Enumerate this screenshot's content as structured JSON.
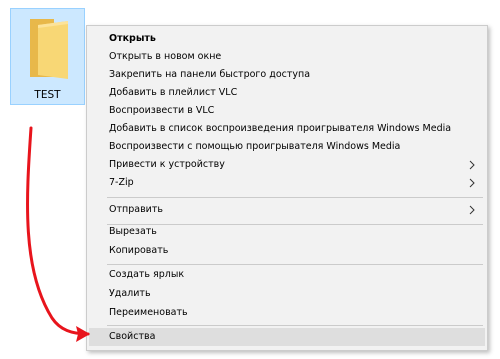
{
  "folder": {
    "name": "TEST",
    "icon": "folder-icon",
    "highlight_color": "#cce8ff"
  },
  "context_menu": {
    "items": [
      {
        "label": "Открыть",
        "bold": true
      },
      {
        "label": "Открыть в новом окне"
      },
      {
        "label": "Закрепить на панели быстрого доступа"
      },
      {
        "label": "Добавить в плейлист VLC"
      },
      {
        "label": "Воспроизвести в VLC"
      },
      {
        "label": "Добавить в список воспроизведения проигрывателя Windows Media"
      },
      {
        "label": "Воспроизвести с помощью проигрывателя Windows Media"
      },
      {
        "label": "Привести к устройству",
        "submenu": true
      },
      {
        "label": "7-Zip",
        "submenu": true
      },
      {
        "label": "Отправить",
        "submenu": true
      },
      {
        "label": "Вырезать"
      },
      {
        "label": "Копировать"
      },
      {
        "label": "Создать ярлык"
      },
      {
        "label": "Удалить"
      },
      {
        "label": "Переименовать"
      },
      {
        "label": "Свойства",
        "hovered": true
      }
    ]
  },
  "annotation": {
    "arrow_color": "#e8141c"
  }
}
